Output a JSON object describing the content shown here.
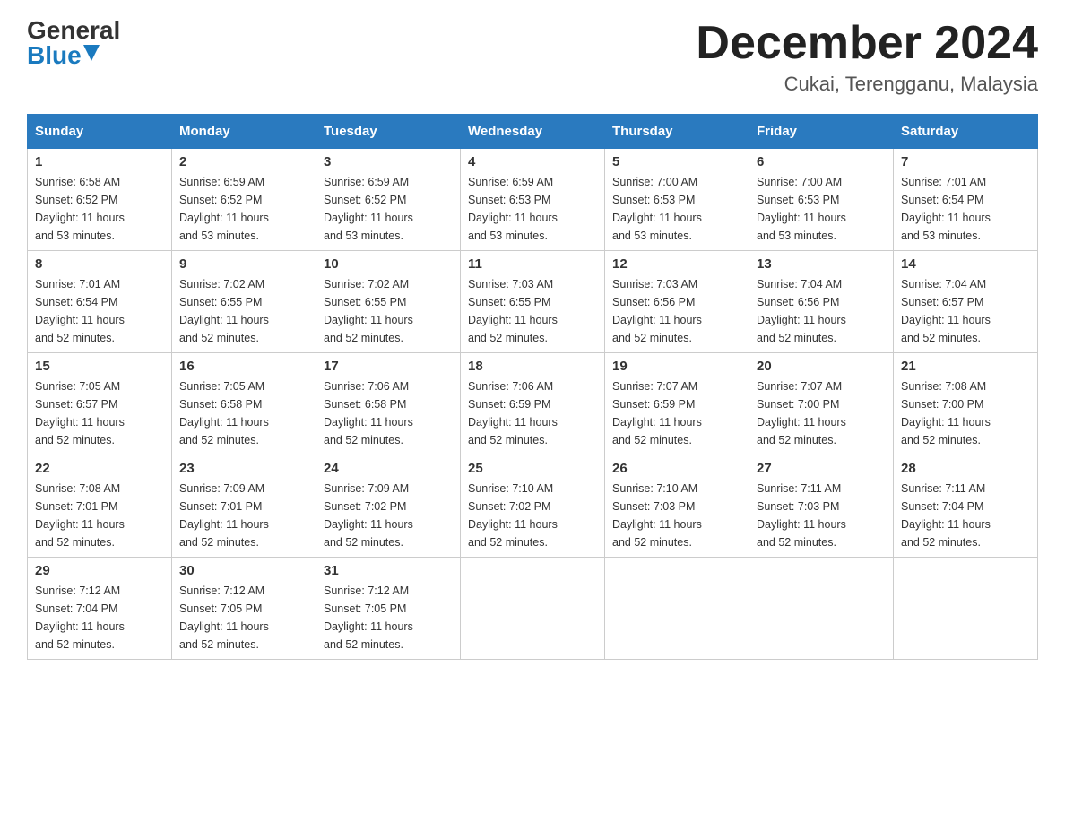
{
  "header": {
    "logo_general": "General",
    "logo_blue": "Blue",
    "main_title": "December 2024",
    "subtitle": "Cukai, Terengganu, Malaysia"
  },
  "calendar": {
    "days_of_week": [
      "Sunday",
      "Monday",
      "Tuesday",
      "Wednesday",
      "Thursday",
      "Friday",
      "Saturday"
    ],
    "weeks": [
      [
        {
          "day": "1",
          "info": "Sunrise: 6:58 AM\nSunset: 6:52 PM\nDaylight: 11 hours\nand 53 minutes."
        },
        {
          "day": "2",
          "info": "Sunrise: 6:59 AM\nSunset: 6:52 PM\nDaylight: 11 hours\nand 53 minutes."
        },
        {
          "day": "3",
          "info": "Sunrise: 6:59 AM\nSunset: 6:52 PM\nDaylight: 11 hours\nand 53 minutes."
        },
        {
          "day": "4",
          "info": "Sunrise: 6:59 AM\nSunset: 6:53 PM\nDaylight: 11 hours\nand 53 minutes."
        },
        {
          "day": "5",
          "info": "Sunrise: 7:00 AM\nSunset: 6:53 PM\nDaylight: 11 hours\nand 53 minutes."
        },
        {
          "day": "6",
          "info": "Sunrise: 7:00 AM\nSunset: 6:53 PM\nDaylight: 11 hours\nand 53 minutes."
        },
        {
          "day": "7",
          "info": "Sunrise: 7:01 AM\nSunset: 6:54 PM\nDaylight: 11 hours\nand 53 minutes."
        }
      ],
      [
        {
          "day": "8",
          "info": "Sunrise: 7:01 AM\nSunset: 6:54 PM\nDaylight: 11 hours\nand 52 minutes."
        },
        {
          "day": "9",
          "info": "Sunrise: 7:02 AM\nSunset: 6:55 PM\nDaylight: 11 hours\nand 52 minutes."
        },
        {
          "day": "10",
          "info": "Sunrise: 7:02 AM\nSunset: 6:55 PM\nDaylight: 11 hours\nand 52 minutes."
        },
        {
          "day": "11",
          "info": "Sunrise: 7:03 AM\nSunset: 6:55 PM\nDaylight: 11 hours\nand 52 minutes."
        },
        {
          "day": "12",
          "info": "Sunrise: 7:03 AM\nSunset: 6:56 PM\nDaylight: 11 hours\nand 52 minutes."
        },
        {
          "day": "13",
          "info": "Sunrise: 7:04 AM\nSunset: 6:56 PM\nDaylight: 11 hours\nand 52 minutes."
        },
        {
          "day": "14",
          "info": "Sunrise: 7:04 AM\nSunset: 6:57 PM\nDaylight: 11 hours\nand 52 minutes."
        }
      ],
      [
        {
          "day": "15",
          "info": "Sunrise: 7:05 AM\nSunset: 6:57 PM\nDaylight: 11 hours\nand 52 minutes."
        },
        {
          "day": "16",
          "info": "Sunrise: 7:05 AM\nSunset: 6:58 PM\nDaylight: 11 hours\nand 52 minutes."
        },
        {
          "day": "17",
          "info": "Sunrise: 7:06 AM\nSunset: 6:58 PM\nDaylight: 11 hours\nand 52 minutes."
        },
        {
          "day": "18",
          "info": "Sunrise: 7:06 AM\nSunset: 6:59 PM\nDaylight: 11 hours\nand 52 minutes."
        },
        {
          "day": "19",
          "info": "Sunrise: 7:07 AM\nSunset: 6:59 PM\nDaylight: 11 hours\nand 52 minutes."
        },
        {
          "day": "20",
          "info": "Sunrise: 7:07 AM\nSunset: 7:00 PM\nDaylight: 11 hours\nand 52 minutes."
        },
        {
          "day": "21",
          "info": "Sunrise: 7:08 AM\nSunset: 7:00 PM\nDaylight: 11 hours\nand 52 minutes."
        }
      ],
      [
        {
          "day": "22",
          "info": "Sunrise: 7:08 AM\nSunset: 7:01 PM\nDaylight: 11 hours\nand 52 minutes."
        },
        {
          "day": "23",
          "info": "Sunrise: 7:09 AM\nSunset: 7:01 PM\nDaylight: 11 hours\nand 52 minutes."
        },
        {
          "day": "24",
          "info": "Sunrise: 7:09 AM\nSunset: 7:02 PM\nDaylight: 11 hours\nand 52 minutes."
        },
        {
          "day": "25",
          "info": "Sunrise: 7:10 AM\nSunset: 7:02 PM\nDaylight: 11 hours\nand 52 minutes."
        },
        {
          "day": "26",
          "info": "Sunrise: 7:10 AM\nSunset: 7:03 PM\nDaylight: 11 hours\nand 52 minutes."
        },
        {
          "day": "27",
          "info": "Sunrise: 7:11 AM\nSunset: 7:03 PM\nDaylight: 11 hours\nand 52 minutes."
        },
        {
          "day": "28",
          "info": "Sunrise: 7:11 AM\nSunset: 7:04 PM\nDaylight: 11 hours\nand 52 minutes."
        }
      ],
      [
        {
          "day": "29",
          "info": "Sunrise: 7:12 AM\nSunset: 7:04 PM\nDaylight: 11 hours\nand 52 minutes."
        },
        {
          "day": "30",
          "info": "Sunrise: 7:12 AM\nSunset: 7:05 PM\nDaylight: 11 hours\nand 52 minutes."
        },
        {
          "day": "31",
          "info": "Sunrise: 7:12 AM\nSunset: 7:05 PM\nDaylight: 11 hours\nand 52 minutes."
        },
        {
          "day": "",
          "info": ""
        },
        {
          "day": "",
          "info": ""
        },
        {
          "day": "",
          "info": ""
        },
        {
          "day": "",
          "info": ""
        }
      ]
    ]
  }
}
